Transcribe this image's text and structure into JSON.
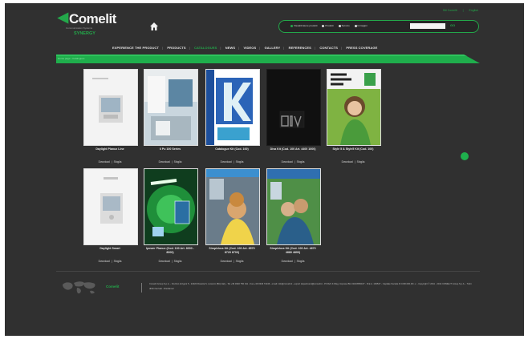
{
  "header": {
    "brand": "Comelit",
    "brand_subtitle": "Communication Systems",
    "brand_tagline": "SYNERGY",
    "top_links": [
      "Siti Comelit",
      "English"
    ],
    "search": {
      "options": [
        {
          "label": "Visualizzatore prodotti",
          "checked": true
        },
        {
          "label": "Prodotti",
          "checked": false
        },
        {
          "label": "Tecnico",
          "checked": false
        },
        {
          "label": "Immagini",
          "checked": false
        }
      ],
      "placeholder": "",
      "go_label": "GO"
    }
  },
  "nav": {
    "items": [
      {
        "label": "EXPERIENCE THE PRODUCT",
        "active": false
      },
      {
        "label": "PRODUCTS",
        "active": false
      },
      {
        "label": "CATALOGUES",
        "active": true
      },
      {
        "label": "NEWS",
        "active": false
      },
      {
        "label": "VIDEOS",
        "active": false
      },
      {
        "label": "GALLERY",
        "active": false
      },
      {
        "label": "REFERENCES",
        "active": false
      },
      {
        "label": "CONTACTS",
        "active": false
      },
      {
        "label": "PRESS COVERAGE",
        "active": false
      }
    ]
  },
  "breadcrumb": "Home page › Catalogues",
  "catalogues": [
    {
      "title": "Daylight Planux Line",
      "actions": [
        "Download",
        "Sfoglia"
      ]
    },
    {
      "title": "6 Pu 100 Series",
      "actions": [
        "Download",
        "Sfoglia"
      ]
    },
    {
      "title": "Catalogue Kit (Cod. 100)",
      "actions": [
        "Download",
        "Sfoglia"
      ]
    },
    {
      "title": "Diva Kit (Cod. 100 Art. 4400 1000)",
      "actions": [
        "Download",
        "Sfoglia"
      ]
    },
    {
      "title": "Style 5 & Style5 Kit (Cod. 100)",
      "actions": [
        "Download",
        "Sfoglia"
      ]
    },
    {
      "title": "Daylight Smart",
      "actions": [
        "Download",
        "Sfoglia"
      ]
    },
    {
      "title": "Ipower Planux (Cod. 100 Art. 8000 - 8000)",
      "actions": [
        "Download",
        "Sfoglia"
      ]
    },
    {
      "title": "Simplebus Kit (Cod. 100 Art. 8570 8720 8700)",
      "actions": [
        "Download",
        "Sfoglia"
      ]
    },
    {
      "title": "Simplebus Kit (Cod. 100 Art. 4870 4880 4890)",
      "actions": [
        "Download",
        "Sfoglia"
      ]
    }
  ],
  "footer": {
    "brand": "Comelit",
    "text": "Comelit Group S.p.A. - Via Don Arrigoni 5 - 24020 Rovetta S. Lorenzo (BG) Italy - Tel +39 0346 750 011 - Fax +39 0346 71436 - email: info@comelit.it - export department@comelit.it - P.IVA/C.F./Reg. Imprese BG 01164550167 - R.E.A. 193547 - Capitale Sociale € 3.000.000,00 i.v. - Copyright © 2011 - 2014 COMELIT Group S.p.A. - Tutti i diritti riservati - Disclaimer"
  },
  "colors": {
    "accent": "#23a84a",
    "background": "#303030",
    "text": "#e6e6e6"
  }
}
